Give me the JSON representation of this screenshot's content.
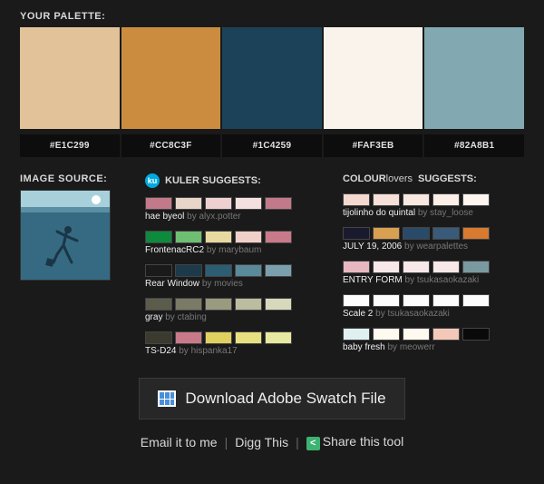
{
  "labels": {
    "your_palette": "YOUR PALETTE:",
    "image_source": "IMAGE SOURCE:",
    "kuler_suggests": "KULER SUGGESTS:",
    "cl_bold": "COLOUR",
    "cl_light": "lovers",
    "cl_suffix": "SUGGESTS:",
    "download": "Download Adobe Swatch File",
    "email": "Email it to me",
    "digg": "Digg This",
    "share": "Share this tool",
    "by": "by"
  },
  "palette": [
    "#E1C299",
    "#CC8C3F",
    "#1C4259",
    "#FAF3EB",
    "#82A8B1"
  ],
  "kuler": [
    {
      "name": "hae byeol",
      "author": "alyx.potter",
      "colors": [
        "#c27a8a",
        "#e8d5c9",
        "#efd0d0",
        "#f4e1df",
        "#c27a8a"
      ]
    },
    {
      "name": "FrontenacRC2",
      "author": "marybaum",
      "colors": [
        "#0d8a3c",
        "#6fbf73",
        "#e8d9a0",
        "#f0d0c8",
        "#c97a8a"
      ]
    },
    {
      "name": "Rear Window",
      "author": "movies",
      "colors": [
        "#1a1a1a",
        "#1c3a4a",
        "#2d5d73",
        "#5a8999",
        "#7aa0ad"
      ]
    },
    {
      "name": "gray",
      "author": "ctabing",
      "colors": [
        "#5c5c4d",
        "#7a7a66",
        "#9a9a80",
        "#bcbca0",
        "#d8d8bc"
      ]
    },
    {
      "name": "TS-D24",
      "author": "hispanka17",
      "colors": [
        "#3a3a2e",
        "#c97a8a",
        "#e0d060",
        "#e8e080",
        "#e8e8a0"
      ]
    }
  ],
  "colourlovers": [
    {
      "name": "tijolinho do quintal",
      "author": "stay_loose",
      "colors": [
        "#f5d9d0",
        "#f7e0d8",
        "#f9e8e0",
        "#fbefe8",
        "#fdf6f0"
      ]
    },
    {
      "name": "JULY 19, 2006",
      "author": "wearpalettes",
      "colors": [
        "#1a1a2e",
        "#d8a050",
        "#2a4a6a",
        "#3a5a7a",
        "#d87a30"
      ]
    },
    {
      "name": "ENTRY FORM",
      "author": "tsukasaokazaki",
      "colors": [
        "#e8b8c0",
        "#f8e8e8",
        "#f8e8e8",
        "#f8e8e8",
        "#7a9aa0"
      ]
    },
    {
      "name": "Scale 2",
      "author": "tsukasaokazaki",
      "colors": [
        "#fdfdfd",
        "#fdfdfd",
        "#fdfdfd",
        "#fdfdfd",
        "#fdfdfd"
      ]
    },
    {
      "name": "baby fresh",
      "author": "meowerr",
      "colors": [
        "#e0f0f0",
        "#fffaf0",
        "#fffaf0",
        "#f4c8b8",
        "#0a0a0a"
      ]
    }
  ]
}
